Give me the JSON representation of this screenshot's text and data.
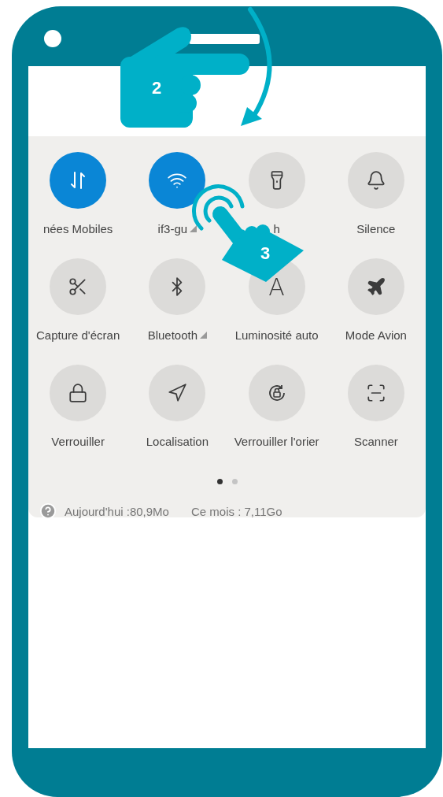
{
  "tiles": [
    {
      "label": "nées Mobiles",
      "selected": true,
      "has_menu": false
    },
    {
      "label": "if3-gu",
      "selected": true,
      "has_menu": true
    },
    {
      "label": "h",
      "selected": false,
      "has_menu": false
    },
    {
      "label": "Silence",
      "selected": false,
      "has_menu": false
    },
    {
      "label": "Capture d'écran",
      "selected": false,
      "has_menu": false
    },
    {
      "label": "Bluetooth",
      "selected": false,
      "has_menu": true
    },
    {
      "glyph": "A",
      "label": "Luminosité auto",
      "selected": false,
      "has_menu": false
    },
    {
      "label": "Mode Avion",
      "selected": false,
      "has_menu": false
    },
    {
      "label": "Verrouiller",
      "selected": false,
      "has_menu": false
    },
    {
      "label": "Localisation",
      "selected": false,
      "has_menu": false
    },
    {
      "label": "Verrouiller l'orier",
      "selected": false,
      "has_menu": false
    },
    {
      "label": "Scanner",
      "selected": false,
      "has_menu": false
    }
  ],
  "page_dots": [
    {
      "selected": true
    },
    {
      "selected": false
    }
  ],
  "usage": {
    "today": "Aujourd'hui :80,9Mo",
    "month": "Ce mois : 7,11Go"
  },
  "gestures": [
    {
      "step": "2"
    },
    {
      "step": "3"
    }
  ]
}
